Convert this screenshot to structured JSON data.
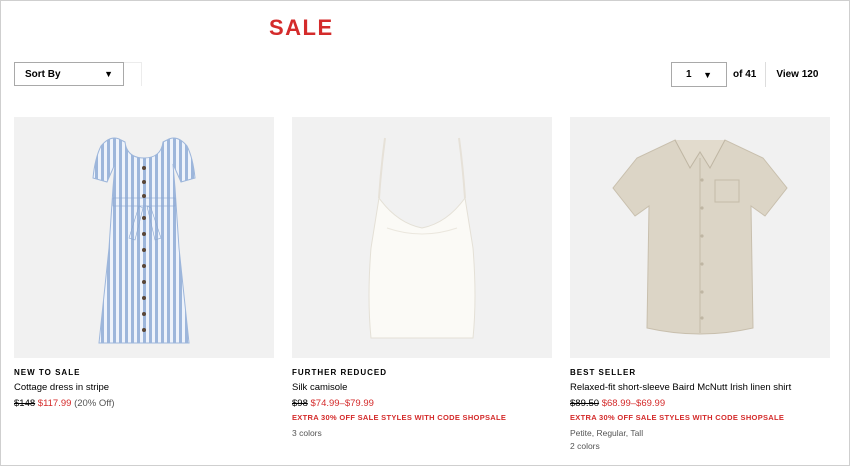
{
  "header": {
    "title": "SALE"
  },
  "toolbar": {
    "sort_label": "Sort By",
    "sort_arrow": "▼",
    "page_value": "1",
    "page_arrow": "▼",
    "of_label": "of 41",
    "view_label": "View 120"
  },
  "products": [
    {
      "badge": "NEW TO SALE",
      "name": "Cottage dress in stripe",
      "original_price": "$148",
      "sale_price": "$117.99",
      "discount": "(20% Off)"
    },
    {
      "badge": "FURTHER REDUCED",
      "name": "Silk camisole",
      "original_price": "$98",
      "sale_price": "$74.99–$79.99",
      "promo": "EXTRA 30% OFF SALE STYLES WITH CODE SHOPSALE",
      "colors": "3 colors"
    },
    {
      "badge": "BEST SELLER",
      "name": "Relaxed-fit short-sleeve Baird McNutt Irish linen shirt",
      "original_price": "$89.50",
      "sale_price": "$68.99–$69.99",
      "promo": "EXTRA 30% OFF SALE STYLES WITH CODE SHOPSALE",
      "sizes": "Petite, Regular, Tall",
      "colors": "2 colors"
    }
  ],
  "colors": {
    "sale_red": "#d42b2b",
    "image_bg": "#f1f1f1"
  }
}
